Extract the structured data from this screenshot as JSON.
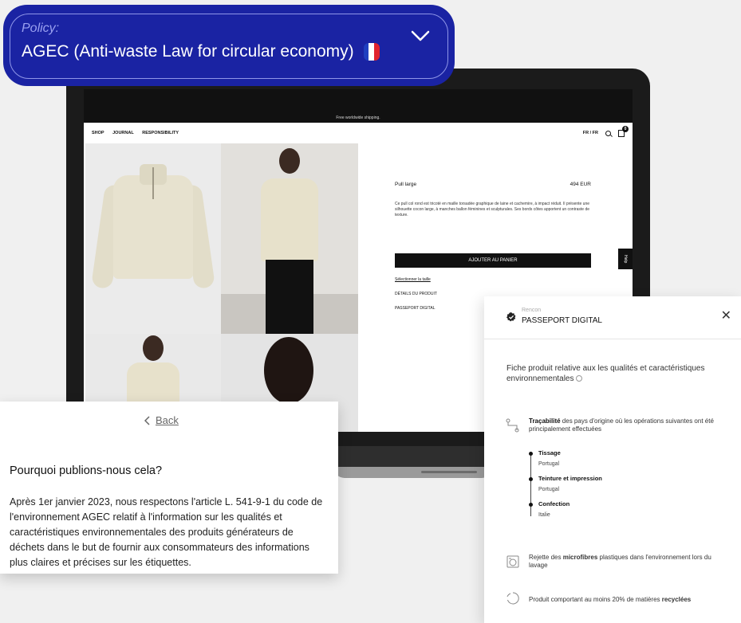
{
  "policy": {
    "label": "Policy:",
    "value": "AGEC (Anti-waste Law for circular economy)",
    "flag_colors": [
      "#1f3fbf",
      "#ffffff",
      "#e0232e"
    ]
  },
  "site": {
    "shipping_banner": "Free worldwide shipping.",
    "nav": [
      "SHOP",
      "JOURNAL",
      "RESPONSIBILITY"
    ],
    "locale": "FR / FR",
    "cart_count": "0",
    "help": "Help"
  },
  "product": {
    "name": "Pull large",
    "price": "494 EUR",
    "description": "Ce pull col rond est tricoté en maille torsadée graphique de laine et cachemire, à impact réduit. Il présente une silhouette cocon large, à manches ballon féminines et sculpturales. Ses bords côtes apportent un contraste de texture.",
    "add_to_cart": "AJOUTER AU PANIER",
    "select_size": "Sélectionner la taille",
    "details": "DÉTAILS DU PRODUIT",
    "passport_link": "PASSEPORT DIGITAL"
  },
  "why": {
    "back": "Back",
    "title": "Pourquoi publions-nous cela?",
    "body": "Après 1er janvier 2023, nous respectons l'article L. 541-9-1 du code de l'environnement AGEC relatif à l'information sur les qualités et caractéristiques environnementales des produits générateurs de déchets dans le but de fournir aux consommateurs des informations plus claires et précises sur les étiquettes."
  },
  "passport": {
    "brand": "Rencon",
    "title": "PASSEPORT DIGITAL",
    "intro": "Fiche produit relative aux les qualités et caractéristiques environnementales",
    "traceability_bold": "Traçabilité",
    "traceability_rest": " des pays d'origine où les opérations suivantes ont été principalement effectuées",
    "steps": [
      {
        "name": "Tissage",
        "country": "Portugal"
      },
      {
        "name": "Teinture et impression",
        "country": "Portugal"
      },
      {
        "name": "Confection",
        "country": "Italie"
      }
    ],
    "fibre_pre": "Rejette des ",
    "fibre_bold": "microfibres",
    "fibre_post": " plastiques dans l'environnement lors du lavage",
    "recycled_pre": "Produit comportant au moins 20% de matières ",
    "recycled_bold": "recyclées"
  }
}
